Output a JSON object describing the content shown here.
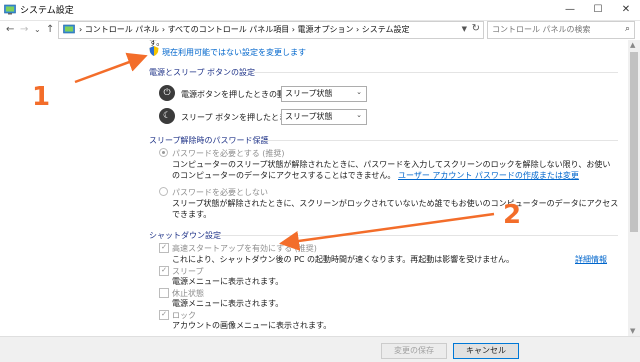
{
  "window": {
    "title": "システム設定",
    "controls": {
      "minimize": "—",
      "maximize": "☐",
      "close": "✕"
    }
  },
  "nav": {
    "back": "←",
    "forward": "→",
    "recent": "⌄",
    "up": "↑",
    "breadcrumbs": "› コントロール パネル  ›  すべてのコントロール パネル項目  ›  電源オプション  ›  システム設定",
    "search_placeholder": "コントロール パネルの検索"
  },
  "content": {
    "top_cut_text": "す。",
    "change_settings_link": "現在利用可能ではない設定を変更します",
    "power_section": {
      "title": "電源とスリープ ボタンの設定",
      "power_button_label": "電源ボタンを押したときの動作:",
      "power_button_value": "スリープ状態",
      "sleep_button_label": "スリープ ボタンを押したときの動作:",
      "sleep_button_value": "スリープ状態"
    },
    "password_section": {
      "title": "スリープ解除時のパスワード保護",
      "require_label": "パスワードを必要とする (推奨)",
      "require_desc_line1": "コンピューターのスリープ状態が解除されたときに、パスワードを入力してスクリーンのロックを解除しない限り、お使い",
      "require_desc_line2": "のコンピューターのデータにアクセスすることはできません。",
      "require_desc_link": "ユーザー アカウント パスワードの作成または変更",
      "norequire_label": "パスワードを必要としない",
      "norequire_desc_line1": "スリープ状態が解除されたときに、スクリーンがロックされていないため誰でもお使いのコンピューターのデータにアクセス",
      "norequire_desc_line2": "できます。"
    },
    "shutdown_section": {
      "title": "シャットダウン設定",
      "fast_startup_label": "高速スタートアップを有効にする (推奨)",
      "fast_startup_desc": "これにより、シャットダウン後の PC の起動時間が速くなります。再起動は影響を受けません。",
      "fast_startup_link": "詳細情報",
      "sleep_label": "スリープ",
      "sleep_desc": "電源メニューに表示されます。",
      "hibernate_label": "休止状態",
      "hibernate_desc": "電源メニューに表示されます。",
      "lock_label": "ロック",
      "lock_desc": "アカウントの画像メニューに表示されます。"
    }
  },
  "footer": {
    "save_label": "変更の保存",
    "cancel_label": "キャンセル"
  },
  "annotations": {
    "marker1": "1",
    "marker2": "2",
    "color": "#f36d2a"
  },
  "checkbox_states": {
    "fast_startup": true,
    "sleep": true,
    "hibernate": false,
    "lock": true
  },
  "radio_states": {
    "require_password": true,
    "no_password": false
  }
}
